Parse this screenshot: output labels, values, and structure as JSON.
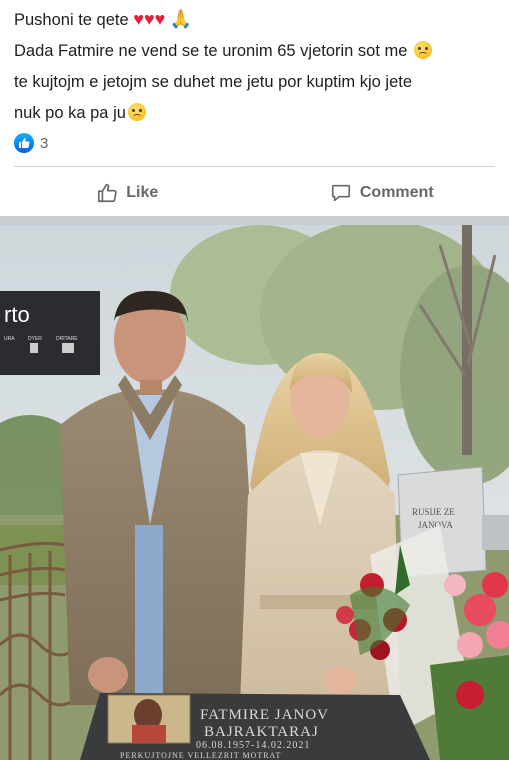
{
  "post": {
    "line1": "Pushoni te qete",
    "line1_emojis": "❤️❤️❤️",
    "line2": "Dada Fatmire ne vend se te uronim 65 vjetorin sot me",
    "line3": "te kujtojm e jetojm se duhet me jetu por kuptim kjo jete",
    "line4": "nuk po ka pa ju",
    "hearts": "♥♥♥",
    "pray": "🙏"
  },
  "reactions": {
    "count": "3",
    "icon": "like-icon"
  },
  "actions": {
    "like_label": "Like",
    "comment_label": "Comment"
  },
  "photo": {
    "billboard_text": "rto",
    "billboard_sub": [
      "URA",
      "DYER",
      "DRITARE"
    ],
    "headstone_text": [
      "RUSIJE ZE",
      "JANOVA"
    ],
    "plaque_name": "FATMIRE JANOV",
    "plaque_surname": "BAJRAKTARAJ",
    "plaque_dates": "06.08.1957-14.02.2021",
    "plaque_footer": "PERKUJTOJNE VELLEZRIT MOTRAT"
  },
  "colors": {
    "accent": "#1877f2",
    "muted": "#65676b"
  }
}
